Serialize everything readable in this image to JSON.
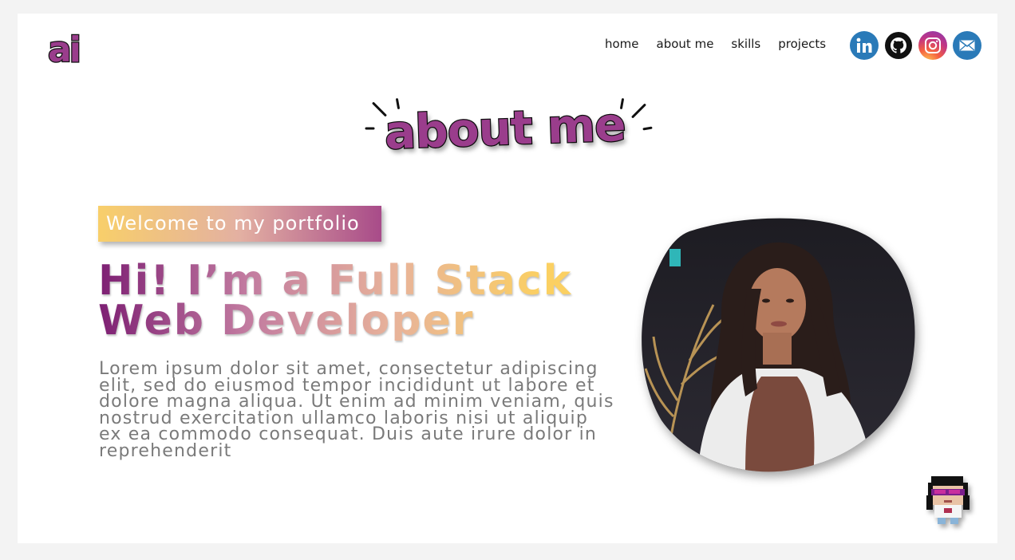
{
  "logo": {
    "text": "ai"
  },
  "nav": {
    "items": [
      "home",
      "about me",
      "skills",
      "projects"
    ]
  },
  "social": [
    "linkedin-icon",
    "github-icon",
    "instagram-icon",
    "mail-icon"
  ],
  "section": {
    "title": "about me"
  },
  "hero": {
    "badge": "Welcome to my portfolio",
    "headline_line1": "Hi! I’m a Full Stack",
    "headline_line2": "Web Developer",
    "body": "Lorem ipsum dolor sit amet, consectetur adipiscing elit, sed do eiusmod tempor incididunt ut labore et dolore magna aliqua. Ut enim ad minim veniam, quis nostrud exercitation ullamco laboris nisi ut aliquip ex ea commodo consequat. Duis aute irure dolor in reprehenderit"
  },
  "colors": {
    "brand_purple": "#9a3d8c",
    "gradient_start": "#7d1f73",
    "gradient_end": "#fbd062",
    "badge_start": "#f8cf6a",
    "badge_end": "#a84b89"
  }
}
